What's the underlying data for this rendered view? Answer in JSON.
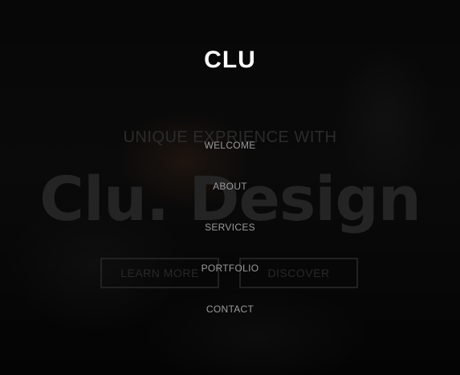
{
  "logo": "CLU",
  "hero": {
    "subtitle": "UNIQUE EXPRIENCE WITH",
    "title": "Clu. Design",
    "buttons": {
      "learn_more": "LEARN MORE",
      "discover": "DISCOVER"
    }
  },
  "menu": {
    "items": [
      {
        "label": "WELCOME"
      },
      {
        "label": "ABOUT"
      },
      {
        "label": "SERVICES"
      },
      {
        "label": "PORTFOLIO"
      },
      {
        "label": "CONTACT"
      }
    ]
  },
  "colors": {
    "overlay": "#050505",
    "logo": "#ffffff",
    "menu_text": "#9a9a9a"
  }
}
